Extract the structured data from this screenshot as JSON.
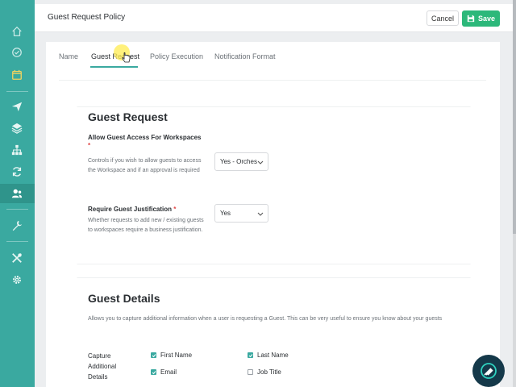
{
  "colors": {
    "sidebar": "#3aa9a0",
    "accent": "#3aa9a0",
    "save": "#2cb87a",
    "required": "#e04848"
  },
  "sidebar": {
    "icons": [
      "home-icon",
      "check-circle-icon",
      "calendar-icon",
      "send-icon",
      "layers-icon",
      "hierarchy-icon",
      "sync-icon",
      "users-icon",
      "wrench-icon",
      "tools-icon",
      "gear-icon"
    ],
    "active": "users-icon"
  },
  "header": {
    "title": "Guest Request Policy",
    "cancel_label": "Cancel",
    "save_label": "Save"
  },
  "tabs": [
    {
      "label": "Name"
    },
    {
      "label": "Guest Request",
      "active": true
    },
    {
      "label": "Policy Execution"
    },
    {
      "label": "Notification Format"
    }
  ],
  "guest_request": {
    "title": "Guest Request",
    "allow_access": {
      "label": "Allow Guest Access For Workspaces",
      "required_mark": "*",
      "description": "Controls if you wish to allow guests to access the Workspace and if an approval is required",
      "value": "Yes - Orchestry"
    },
    "justification": {
      "label": "Require Guest Justification",
      "required_mark": "*",
      "description": "Whether requests to add new / existing guests to workspaces require a business justification.",
      "value": "Yes"
    }
  },
  "guest_details": {
    "title": "Guest Details",
    "description": "Allows you to capture additional information when a user is requesting a Guest. This can be very useful to ensure you know about your guests",
    "capture_label": "Capture Additional Details",
    "fields": [
      {
        "label": "First Name",
        "checked": true
      },
      {
        "label": "Last Name",
        "checked": true
      },
      {
        "label": "Email",
        "checked": true
      },
      {
        "label": "Job Title",
        "checked": false
      }
    ]
  }
}
